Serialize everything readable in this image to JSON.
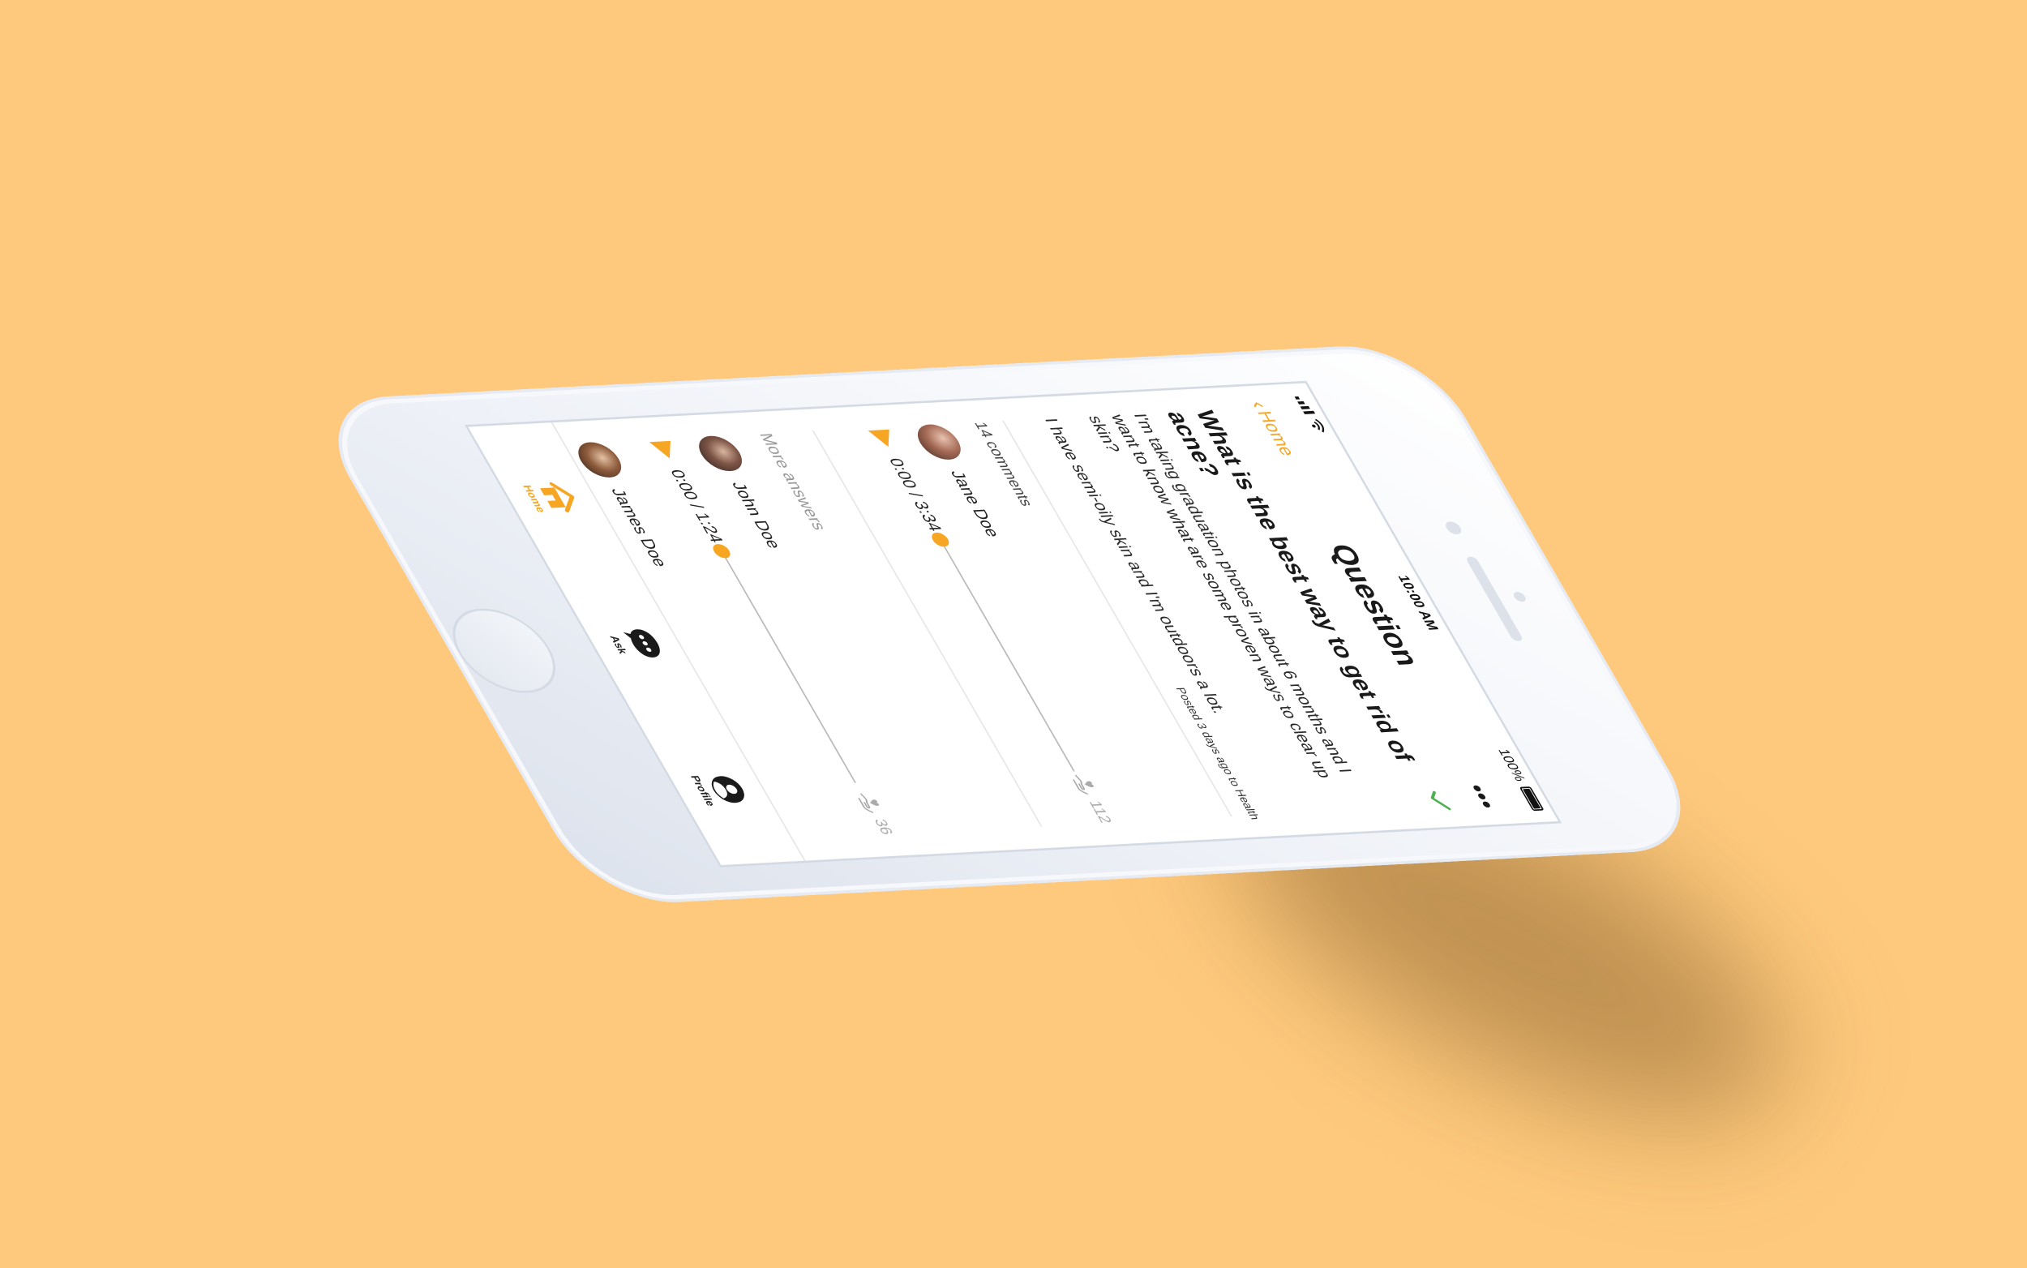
{
  "status_bar": {
    "time": "10:00 AM",
    "battery": "100%"
  },
  "nav": {
    "back_label": "Home",
    "title": "Question"
  },
  "question": {
    "title": "What is the best way to get rid of acne?",
    "body": "I'm taking graduation photos in about 6 months and I want to know what are some proven ways to clear up skin?",
    "body2": "I have semi-oily skin and I'm outdoors a lot.",
    "meta": "Posted 3 days ago to Health"
  },
  "comments_label": "14 comments",
  "answers": [
    {
      "name": "Jane Doe",
      "time": "0:00 / 3:34",
      "likes": "112",
      "progress": 0
    },
    {
      "name": "John Doe",
      "time": "0:00 / 1:24",
      "likes": "36",
      "progress": 0
    },
    {
      "name": "James Doe"
    }
  ],
  "more_answers_label": "More answers",
  "tabs": [
    {
      "label": "Home",
      "icon": "house-icon",
      "active": true
    },
    {
      "label": "Ask",
      "icon": "chat-bubble-icon",
      "active": false
    },
    {
      "label": "Profile",
      "icon": "user-circle-icon",
      "active": false
    }
  ],
  "colors": {
    "background": "#FEC97C",
    "accent": "#F6A623",
    "check": "#4CAF50"
  }
}
